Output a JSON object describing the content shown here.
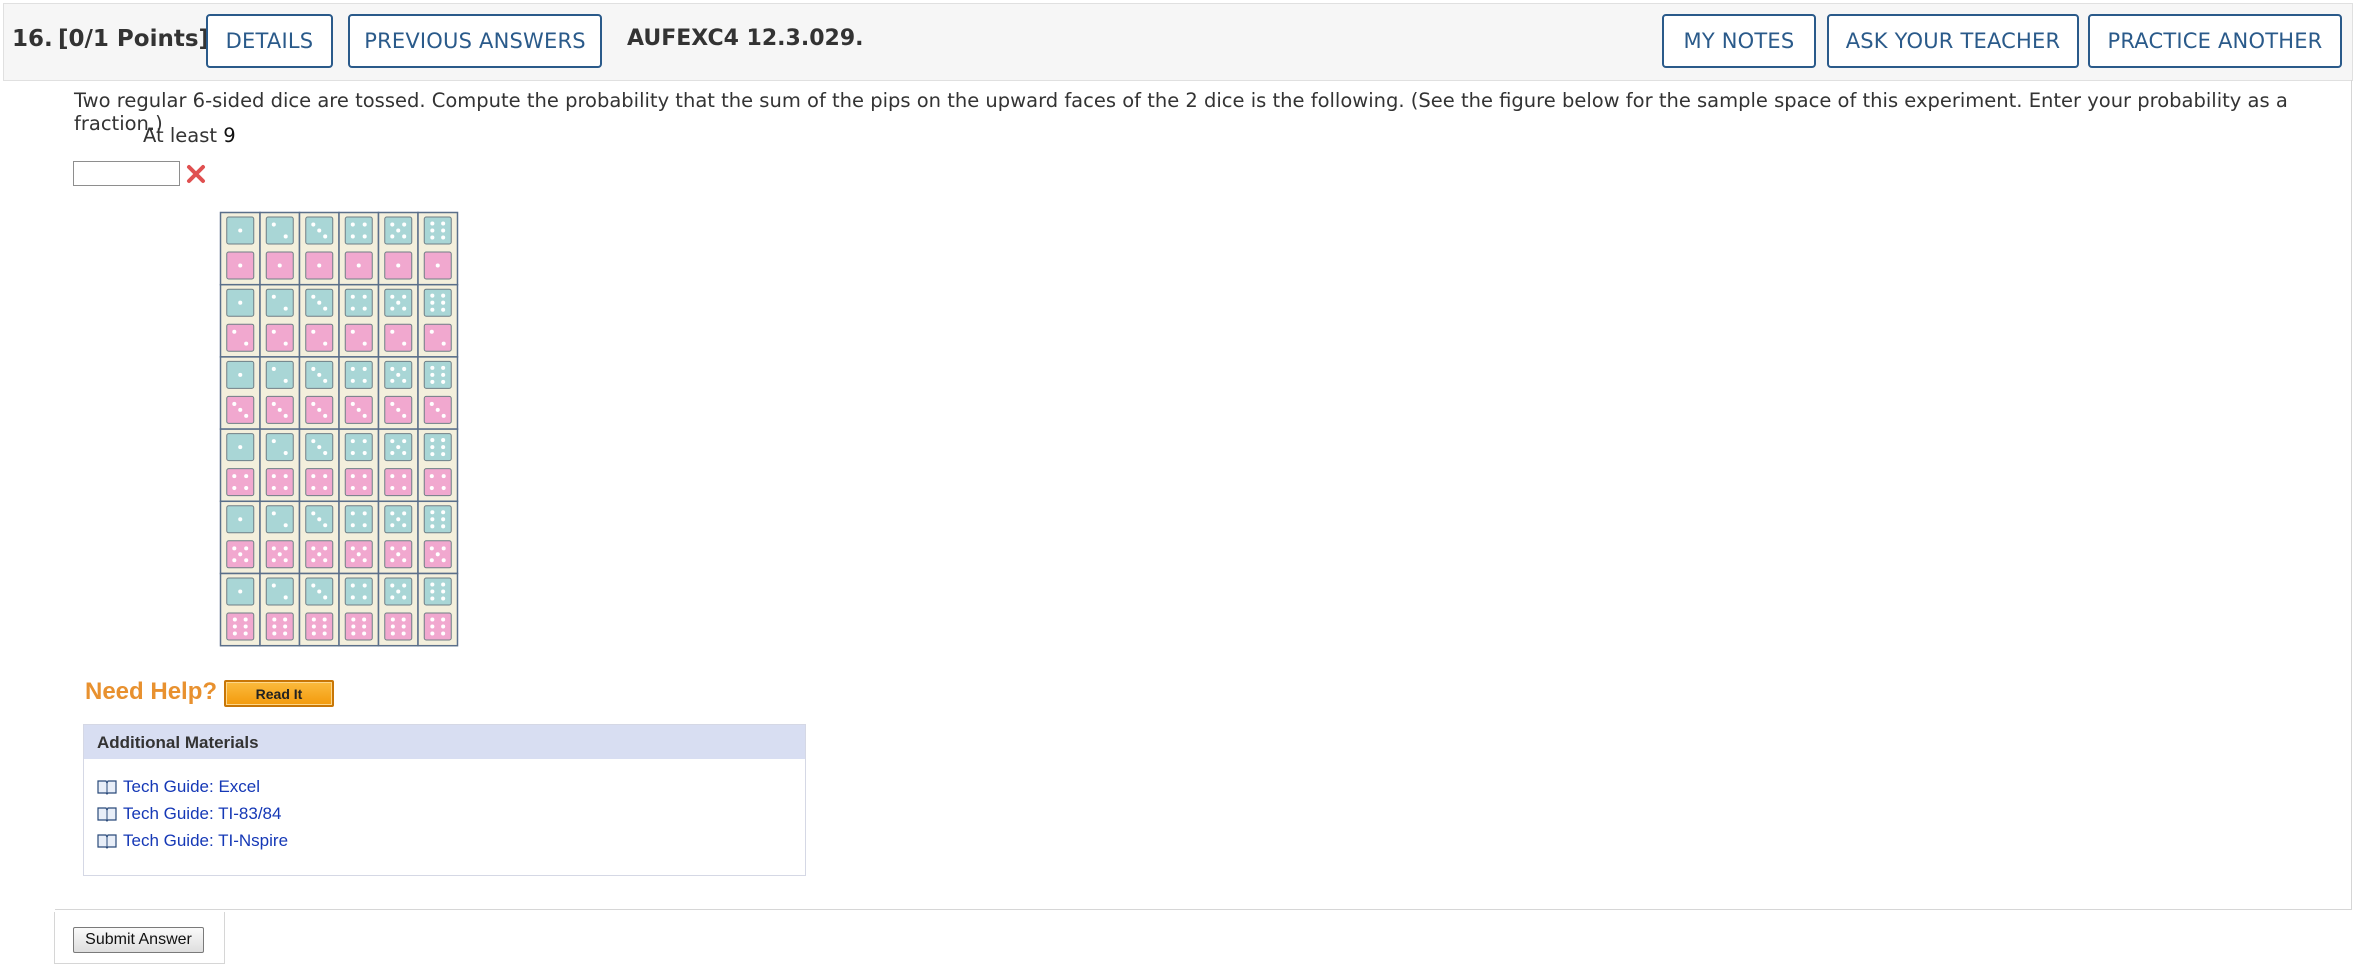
{
  "header": {
    "question_number": "16.",
    "points": "[0/1 Points]",
    "details_label": "DETAILS",
    "previous_answers_label": "PREVIOUS ANSWERS",
    "question_code": "AUFEXC4 12.3.029.",
    "my_notes_label": "MY NOTES",
    "ask_teacher_label": "ASK YOUR TEACHER",
    "practice_another_label": "PRACTICE ANOTHER"
  },
  "question": {
    "text": "Two regular 6-sided dice are tossed. Compute the probability that the sum of the pips on the upward faces of the 2 dice is the following. (See the figure below for the sample space of this experiment. Enter your probability as a fraction.)",
    "condition_prefix": "At least",
    "condition_value": "9",
    "answer_value": "",
    "answer_status": "incorrect"
  },
  "dice_figure": {
    "first_die_color": "#a9d6d6",
    "second_die_color": "#f1a8cf",
    "cell_background": "#f3efdc",
    "grid_border_color": "#5a6f8a",
    "rows": 6,
    "cols": 6
  },
  "help": {
    "need_help_label": "Need Help?",
    "read_it_label": "Read It"
  },
  "materials": {
    "title": "Additional Materials",
    "links": [
      "Tech Guide: Excel",
      "Tech Guide: TI-83/84",
      "Tech Guide: TI-Nspire"
    ]
  },
  "submit_label": "Submit Answer",
  "colors": {
    "button_border": "#2a5a8a",
    "need_help": "#e8912f",
    "link": "#1538b6",
    "wrong": "#e05050"
  }
}
